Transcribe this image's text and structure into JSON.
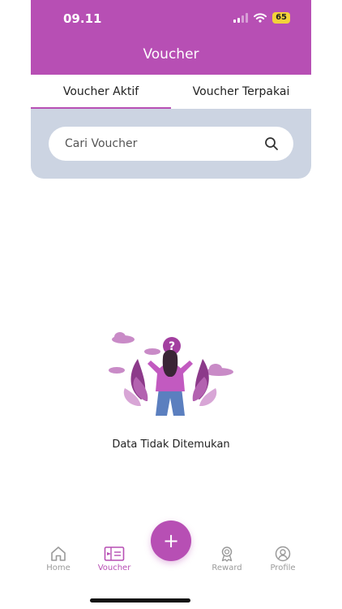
{
  "status_bar": {
    "time": "09.11",
    "battery": "65"
  },
  "header": {
    "title": "Voucher"
  },
  "tabs": [
    {
      "label": "Voucher Aktif",
      "active": true
    },
    {
      "label": "Voucher Terpakai",
      "active": false
    }
  ],
  "search": {
    "placeholder": "Cari Voucher",
    "value": ""
  },
  "empty_state": {
    "message": "Data Tidak Ditemukan"
  },
  "fab": {
    "label": "+"
  },
  "bottom_nav": [
    {
      "label": "Home",
      "icon": "home-icon",
      "active": false
    },
    {
      "label": "Voucher",
      "icon": "voucher-icon",
      "active": true
    },
    {
      "label": "Reward",
      "icon": "reward-icon",
      "active": false
    },
    {
      "label": "Profile",
      "icon": "profile-icon",
      "active": false
    }
  ],
  "colors": {
    "primary": "#b74fb4",
    "search_panel": "#ccd4e2",
    "inactive": "#9a9a9a"
  }
}
